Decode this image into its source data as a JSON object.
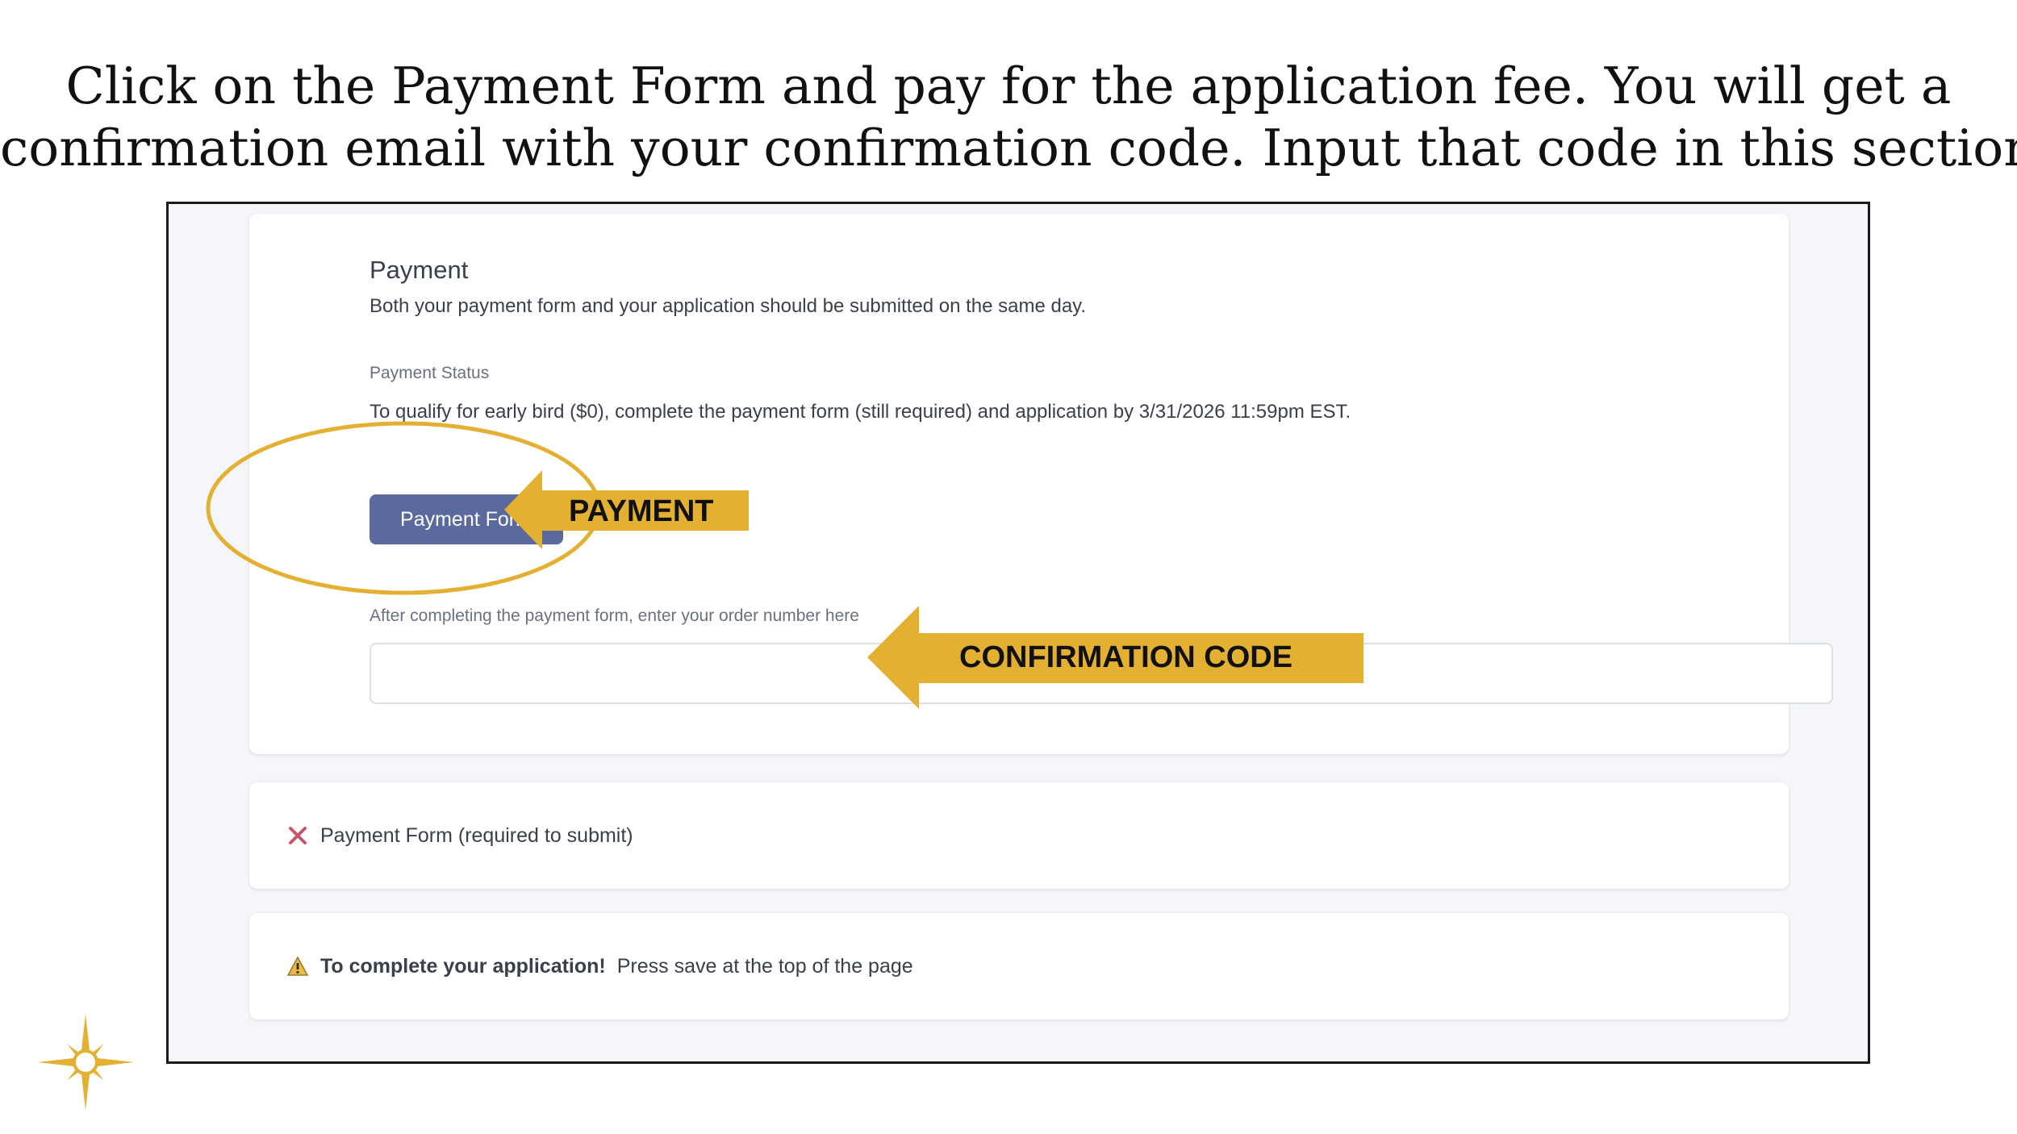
{
  "instruction": {
    "line1": "Click on the Payment Form and pay for the application fee. You will get a",
    "line2": "confirmation email with your confirmation code. Input that code in this section."
  },
  "payment_section": {
    "title": "Payment",
    "description": "Both your payment form and your application should be submitted on the same day.",
    "status_label": "Payment Status",
    "early_bird_text": "To qualify for early bird ($0), complete the payment form (still required) and application by 3/31/2026 11:59pm EST.",
    "button_label": "Payment Form",
    "order_label": "After completing the payment form, enter your order number here",
    "order_value": ""
  },
  "requirement_row": {
    "icon": "x-icon",
    "text": "Payment Form (required to submit)"
  },
  "notice_row": {
    "icon": "warning-icon",
    "strong_text": "To complete your application!",
    "text": "Press save at the top of the page"
  },
  "annotations": {
    "payment_arrow_label": "PAYMENT",
    "confirmation_arrow_label": "CONFIRMATION CODE"
  },
  "colors": {
    "accent_gold": "#e4b032",
    "button_blue": "#5b6a9e",
    "error_red": "#c8566b"
  },
  "decoration": {
    "logo_icon": "star-icon"
  }
}
